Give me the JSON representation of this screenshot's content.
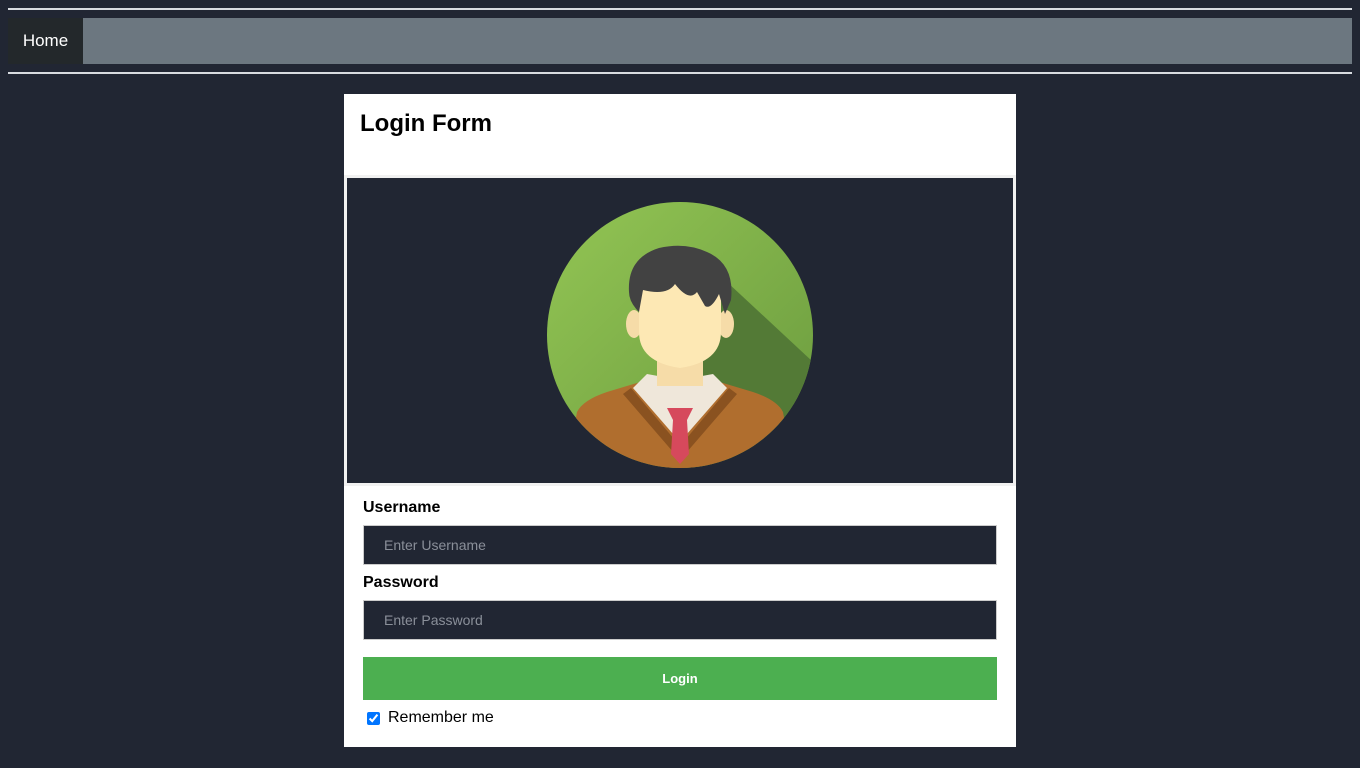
{
  "nav": {
    "home_label": "Home"
  },
  "login_form": {
    "title": "Login Form",
    "avatar_icon": "user-avatar-icon",
    "username": {
      "label": "Username",
      "placeholder": "Enter Username",
      "value": ""
    },
    "password": {
      "label": "Password",
      "placeholder": "Enter Password",
      "value": ""
    },
    "login_label": "Login",
    "remember": {
      "label": "Remember me",
      "checked": true
    }
  },
  "colors": {
    "page_background": "#212633",
    "navbar": "#6c7780",
    "nav_active": "#23282b",
    "login_button": "#4caf50",
    "card": "#ffffff"
  }
}
